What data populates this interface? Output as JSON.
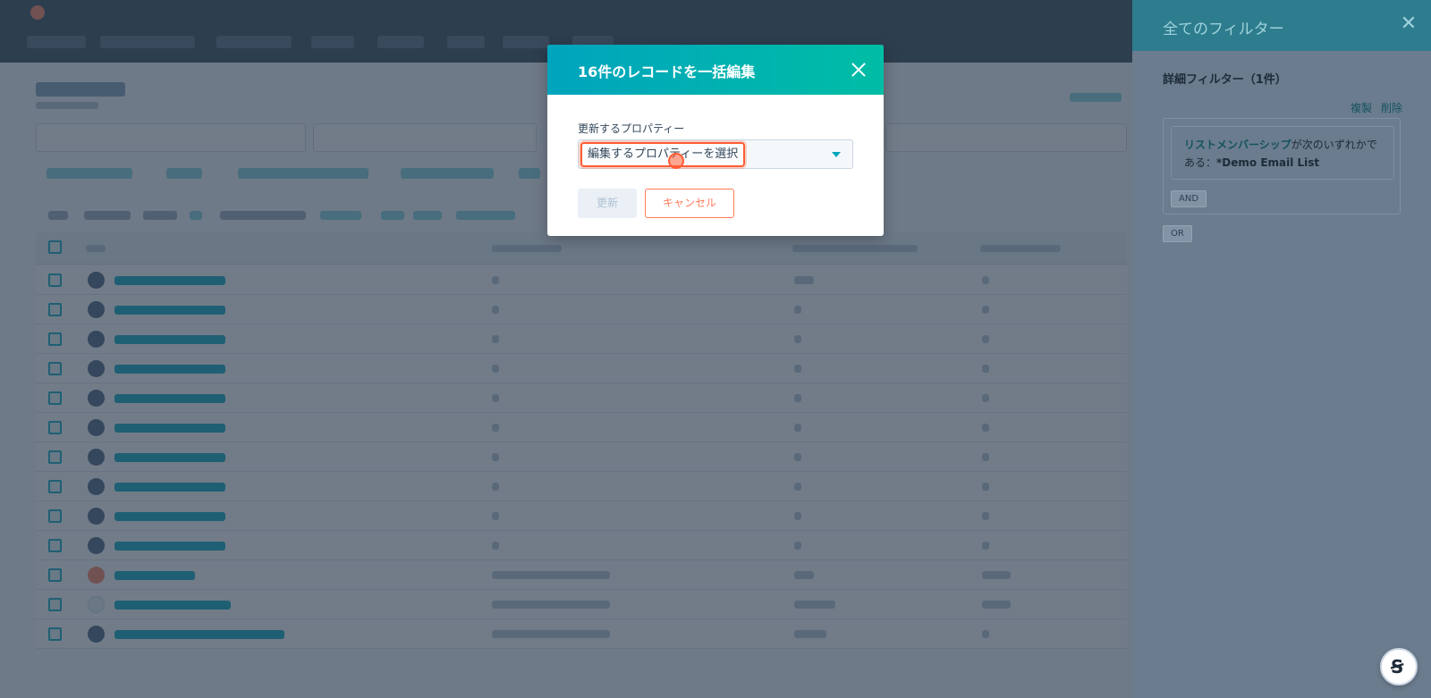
{
  "modal": {
    "title": "16件のレコードを一括編集",
    "field_label": "更新するプロパティー",
    "select_placeholder": "編集するプロパティーを選択",
    "update_label": "更新",
    "cancel_label": "キャンセル",
    "close_icon": "close-icon"
  },
  "filter_panel": {
    "title": "全てのフィルター",
    "subtitle": "詳細フィルター（1件）",
    "duplicate_label": "複製",
    "delete_label": "削除",
    "filter_property": "リストメンバーシップ",
    "filter_text": "が次のいずれかである：",
    "filter_value": "*Demo Email List",
    "and_label": "AND",
    "or_label": "OR",
    "close_glyph": "✕"
  },
  "help": {
    "glyph": "Ꞩ"
  },
  "colors": {
    "accent": "#00a4bd",
    "brand_orange": "#ff7a59",
    "highlight": "#ff5c35",
    "nav_dark": "#2d3e50"
  }
}
